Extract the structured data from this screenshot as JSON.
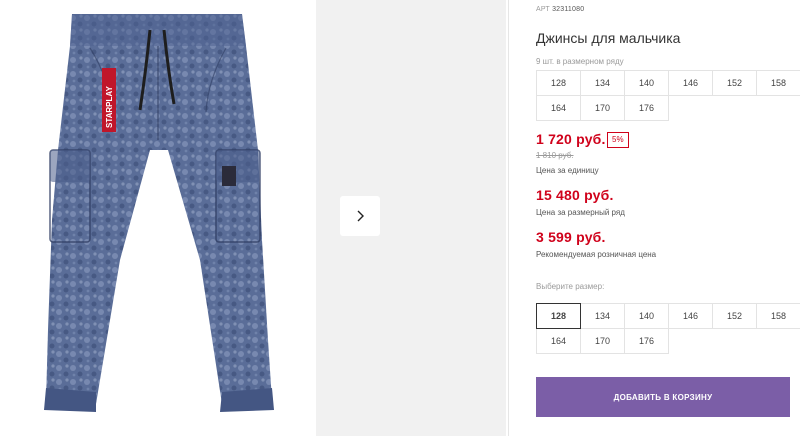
{
  "product": {
    "art_label": "АРТ",
    "art_value": "32311080",
    "title": "Джинсы для мальчика",
    "range_label": "9 шт. в размерном ряду",
    "range_sizes": [
      "128",
      "134",
      "140",
      "146",
      "152",
      "158",
      "164",
      "170",
      "176"
    ]
  },
  "prices": {
    "unit_price": "1 720 руб.",
    "discount": "5%",
    "old_price": "1 810 руб.",
    "unit_caption": "Цена за единицу",
    "range_price": "15 480 руб.",
    "range_caption": "Цена за размерный ряд",
    "retail_price": "3 599 руб.",
    "retail_caption": "Рекомендуемая розничная цена"
  },
  "size_select": {
    "label": "Выберите размер:",
    "options": [
      "128",
      "134",
      "140",
      "146",
      "152",
      "158",
      "164",
      "170",
      "176"
    ],
    "selected": "128"
  },
  "actions": {
    "add_to_cart": "ДОБАВИТЬ В КОРЗИНУ"
  },
  "image": {
    "tag_text": "STARPLAY",
    "colors": {
      "denim": "#5a6d98",
      "denim_light": "#8fa0c2",
      "denim_dark": "#2f3d63",
      "tag_red": "#c0162a"
    }
  },
  "colors": {
    "accent_red": "#d0021b",
    "button_purple": "#7b5ea7",
    "gallery_bg": "#f1f1f1"
  },
  "icons": {
    "next": "chevron-right-icon"
  }
}
